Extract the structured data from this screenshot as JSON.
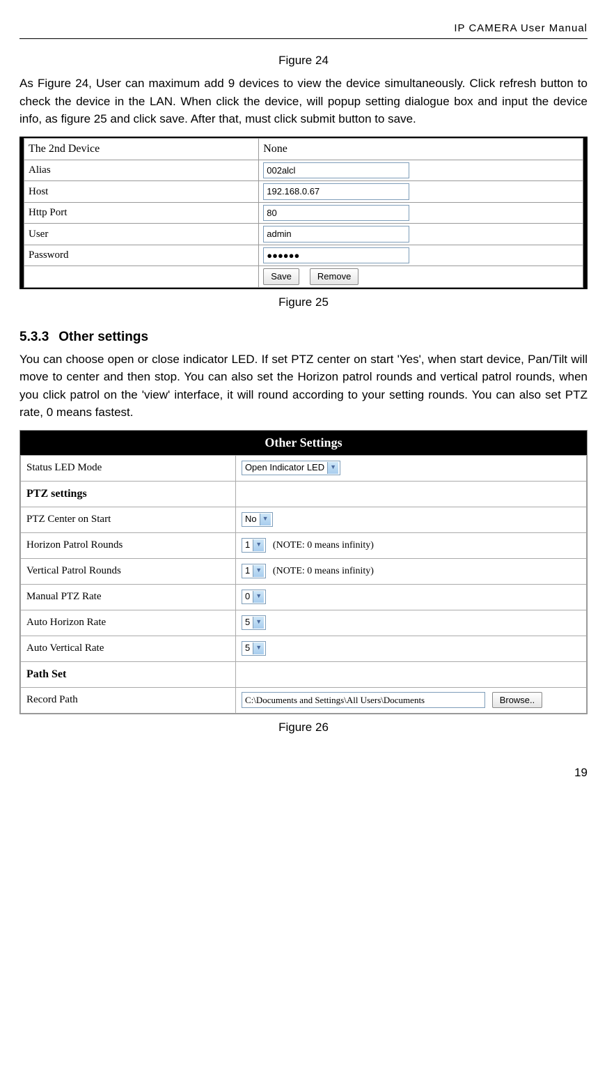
{
  "header": "IP  CAMERA  User  Manual",
  "caption24": "Figure 24",
  "para1": "As Figure 24, User can maximum add 9 devices to view the device simultaneously. Click refresh button to check the device in the LAN. When click the device, will popup setting dialogue box and input the device info, as figure 25 and click save. After that, must click submit button to save.",
  "fig25": {
    "row0_label": "The 2nd Device",
    "row0_value": "None",
    "alias_label": "Alias",
    "alias_value": "002alcl",
    "host_label": "Host",
    "host_value": "192.168.0.67",
    "port_label": "Http Port",
    "port_value": "80",
    "user_label": "User",
    "user_value": "admin",
    "pass_label": "Password",
    "pass_value": "●●●●●●",
    "save_btn": "Save",
    "remove_btn": "Remove"
  },
  "caption25": "Figure 25",
  "section_num": "5.3.3",
  "section_title": "Other settings",
  "para2": "You can choose open or close indicator LED. If set PTZ center on start 'Yes', when start device, Pan/Tilt will move to center and then stop. You can also set the Horizon patrol rounds and vertical patrol rounds, when you click patrol on the 'view' interface, it will round according to your setting rounds. You can also set PTZ rate, 0 means fastest.",
  "fig26": {
    "title": "Other Settings",
    "led_label": "Status LED Mode",
    "led_value": "Open Indicator LED",
    "ptz_heading": "PTZ settings",
    "center_label": "PTZ Center on Start",
    "center_value": "No",
    "horizon_label": "Horizon Patrol Rounds",
    "horizon_value": "1",
    "note": "(NOTE: 0 means infinity)",
    "vertical_label": "Vertical Patrol Rounds",
    "vertical_value": "1",
    "manual_label": "Manual PTZ Rate",
    "manual_value": "0",
    "autoh_label": "Auto Horizon Rate",
    "autoh_value": "5",
    "autov_label": "Auto Vertical Rate",
    "autov_value": "5",
    "path_heading": "Path Set",
    "record_label": "Record Path",
    "record_value": "C:\\Documents and Settings\\All Users\\Documents",
    "browse_btn": "Browse.."
  },
  "caption26": "Figure 26",
  "page_num": "19"
}
